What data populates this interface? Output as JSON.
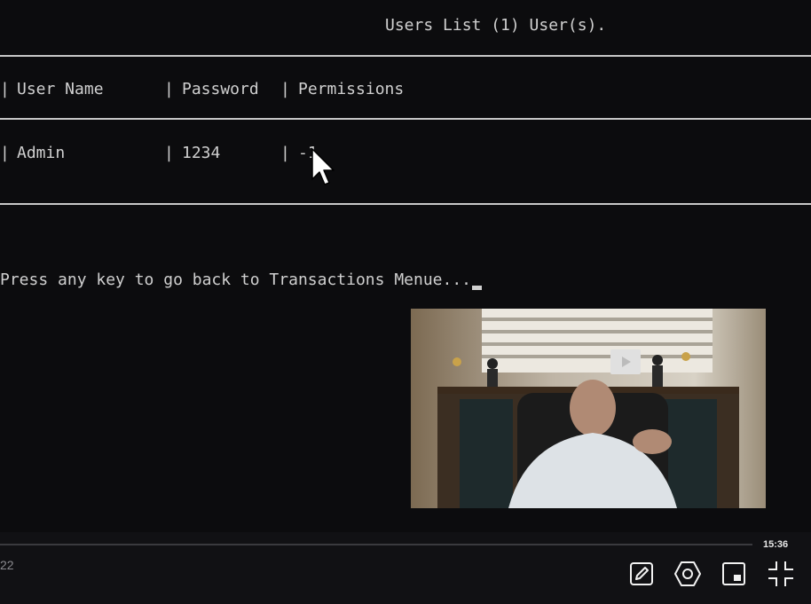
{
  "console": {
    "title": "Users List (1) User(s).",
    "headers": [
      "User Name",
      "Password",
      "Permissions"
    ],
    "rows": [
      {
        "user_name": "Admin",
        "password": "1234",
        "permissions": "-1"
      }
    ],
    "prompt": "Press any key to go back to Transactions Menue..."
  },
  "player": {
    "elapsed": "22",
    "duration": "15:36",
    "progress_fraction": 0.0,
    "icons": [
      "edit-icon",
      "settings-hexagon-icon",
      "picture-in-picture-icon",
      "exit-fullscreen-icon"
    ]
  },
  "colors": {
    "background": "#0c0c0e",
    "text": "#d0d0d0",
    "rule": "#c8c8c8"
  }
}
